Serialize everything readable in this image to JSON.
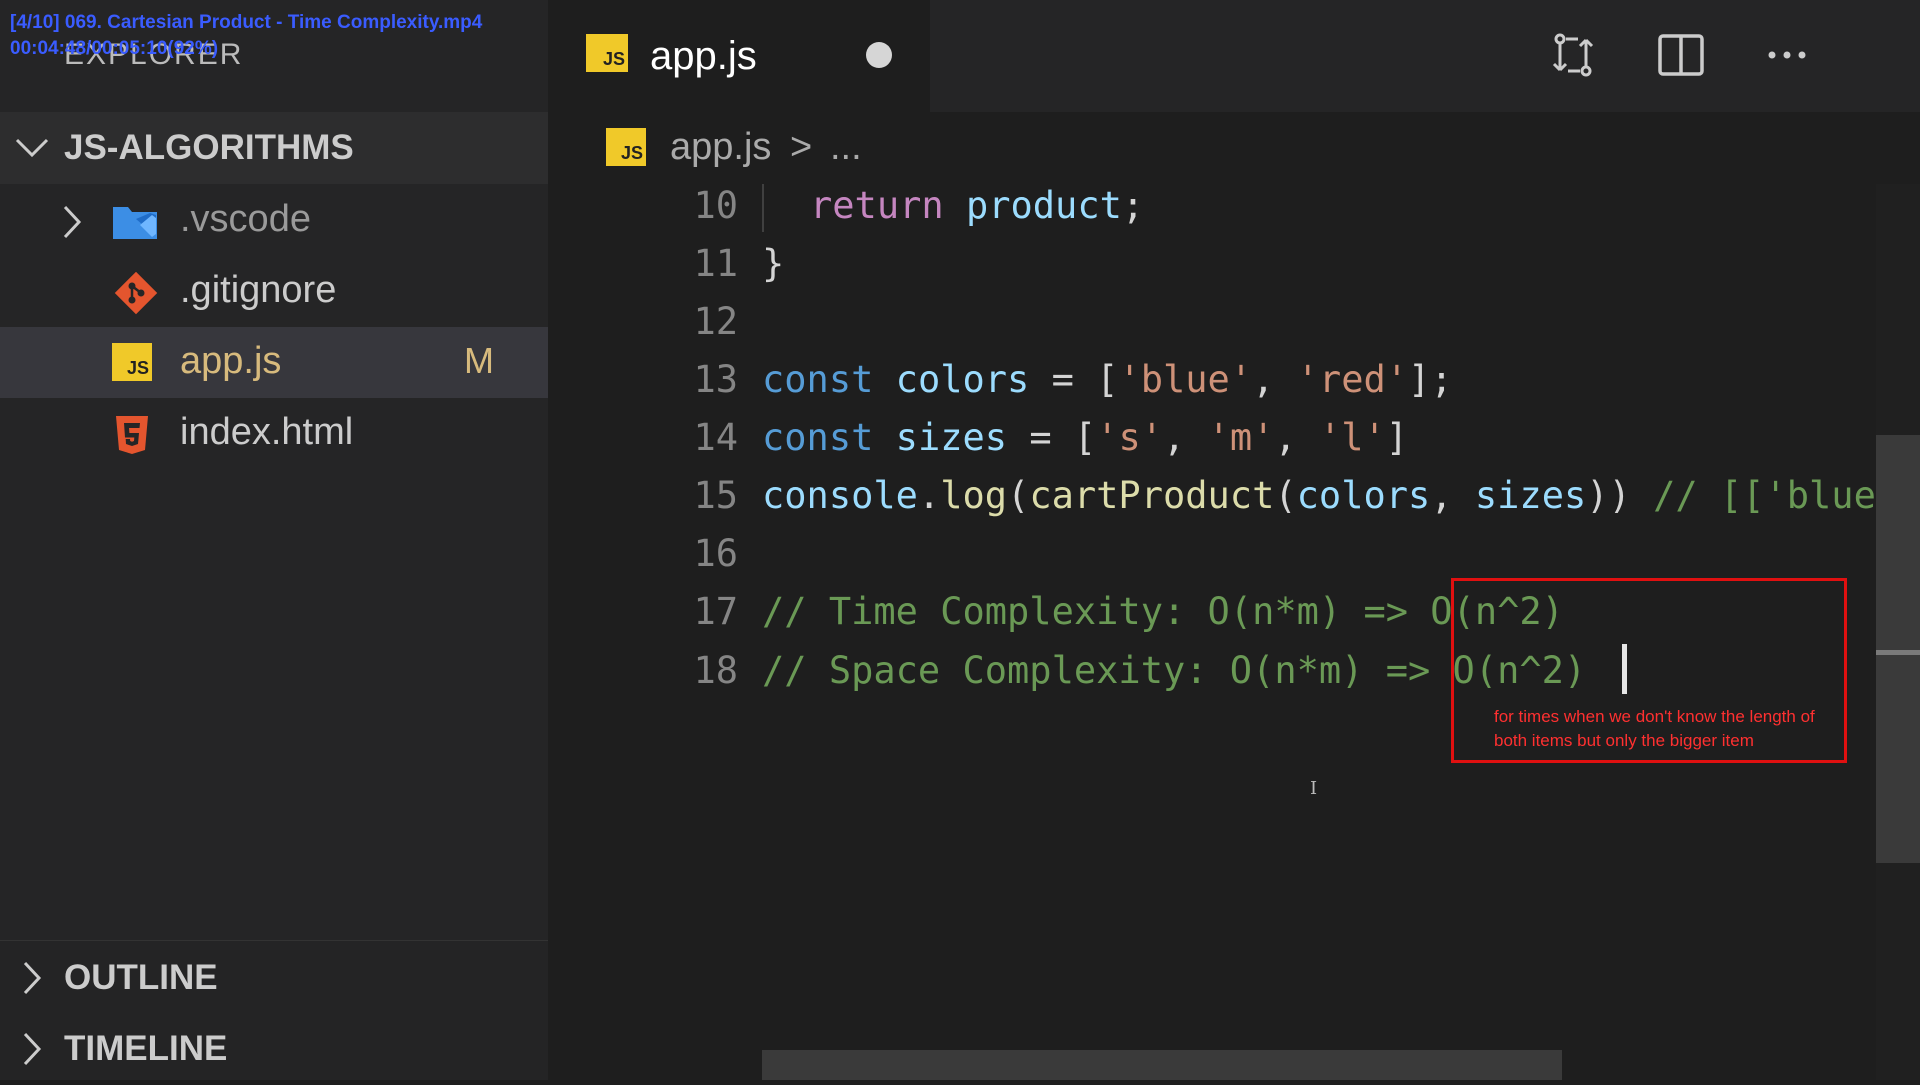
{
  "video_overlay": {
    "line1": "[4/10] 069. Cartesian Product - Time Complexity.mp4",
    "line2": "00:04:48/00:05:10(92%)"
  },
  "sidebar": {
    "title": "EXPLORER",
    "project": "JS-ALGORITHMS",
    "files": [
      {
        "name": ".vscode",
        "icon": "vscode-folder-icon",
        "status": ""
      },
      {
        "name": ".gitignore",
        "icon": "git-icon",
        "status": ""
      },
      {
        "name": "app.js",
        "icon": "js-file-icon",
        "status": "M"
      },
      {
        "name": "index.html",
        "icon": "html5-icon",
        "status": ""
      }
    ],
    "outline": "OUTLINE",
    "timeline": "TIMELINE"
  },
  "tab": {
    "label": "app.js",
    "badge": "JS"
  },
  "breadcrumb": {
    "file": "app.js",
    "separator": ">",
    "more": "..."
  },
  "editor": {
    "lines": [
      {
        "n": "10",
        "segments": [
          {
            "t": "return",
            "c": "kw2"
          },
          {
            "t": " ",
            "c": ""
          },
          {
            "t": "product",
            "c": "var"
          },
          {
            "t": ";",
            "c": ""
          }
        ]
      },
      {
        "n": "11",
        "segments": [
          {
            "t": "}",
            "c": ""
          }
        ]
      },
      {
        "n": "12",
        "segments": []
      },
      {
        "n": "13",
        "segments": [
          {
            "t": "const",
            "c": "kw"
          },
          {
            "t": " ",
            "c": ""
          },
          {
            "t": "colors",
            "c": "var"
          },
          {
            "t": " = [",
            "c": ""
          },
          {
            "t": "'blue'",
            "c": "str"
          },
          {
            "t": ", ",
            "c": ""
          },
          {
            "t": "'red'",
            "c": "str"
          },
          {
            "t": "];",
            "c": ""
          }
        ]
      },
      {
        "n": "14",
        "segments": [
          {
            "t": "const",
            "c": "kw"
          },
          {
            "t": " ",
            "c": ""
          },
          {
            "t": "sizes",
            "c": "var"
          },
          {
            "t": " = [",
            "c": ""
          },
          {
            "t": "'s'",
            "c": "str"
          },
          {
            "t": ", ",
            "c": ""
          },
          {
            "t": "'m'",
            "c": "str"
          },
          {
            "t": ", ",
            "c": ""
          },
          {
            "t": "'l'",
            "c": "str"
          },
          {
            "t": "]",
            "c": ""
          }
        ]
      },
      {
        "n": "15",
        "segments": [
          {
            "t": "console",
            "c": "var"
          },
          {
            "t": ".",
            "c": ""
          },
          {
            "t": "log",
            "c": "fn"
          },
          {
            "t": "(",
            "c": ""
          },
          {
            "t": "cartProduct",
            "c": "fn"
          },
          {
            "t": "(",
            "c": ""
          },
          {
            "t": "colors",
            "c": "var"
          },
          {
            "t": ", ",
            "c": ""
          },
          {
            "t": "sizes",
            "c": "var"
          },
          {
            "t": ")) ",
            "c": ""
          },
          {
            "t": "// [['blue",
            "c": "cmt"
          }
        ]
      },
      {
        "n": "16",
        "segments": []
      },
      {
        "n": "17",
        "segments": [
          {
            "t": "// Time Complexity: O(n*m) => O(n^2)",
            "c": "cmt"
          }
        ]
      },
      {
        "n": "18",
        "segments": [
          {
            "t": "// Space Complexity: O(n*m) => O(n^2)",
            "c": "cmt"
          }
        ]
      }
    ],
    "annotation": "for times when we don't know the length of both items but only the bigger item"
  },
  "colors": {
    "accent_js": "#f0c929",
    "annotation_red": "#e01010"
  }
}
